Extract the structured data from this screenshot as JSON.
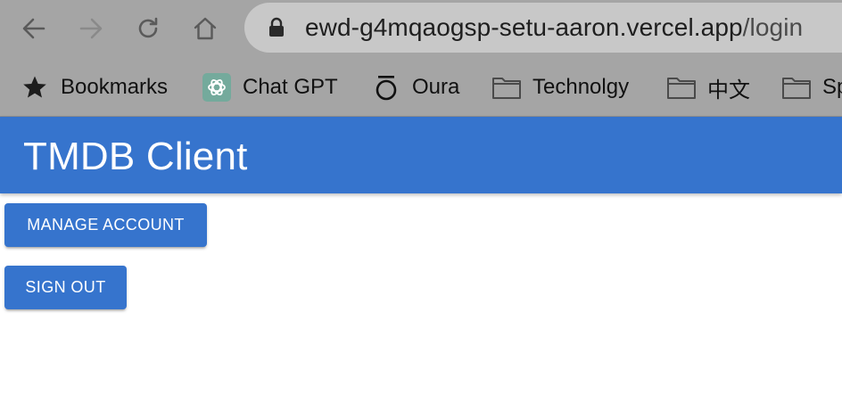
{
  "browser": {
    "url_host": "ewd-g4mqaogsp-setu-aaron.vercel.app",
    "url_path": "/login",
    "bookmarks": [
      {
        "label": "Bookmarks",
        "icon": "star-icon"
      },
      {
        "label": "Chat GPT",
        "icon": "chatgpt-logo-icon"
      },
      {
        "label": "Oura",
        "icon": "oura-logo-icon"
      },
      {
        "label": "Technolgy",
        "icon": "folder-icon"
      },
      {
        "label": "中文",
        "icon": "folder-icon"
      },
      {
        "label": "Sp",
        "icon": "folder-icon"
      }
    ]
  },
  "app": {
    "title": "TMDB Client",
    "buttons": {
      "manage_account": "MANAGE ACCOUNT",
      "sign_out": "SIGN OUT"
    }
  },
  "colors": {
    "chrome_bg": "#a5a5a5",
    "omnibox_bg": "#c8c8c8",
    "primary": "#3674cd",
    "on_primary": "#ffffff"
  }
}
